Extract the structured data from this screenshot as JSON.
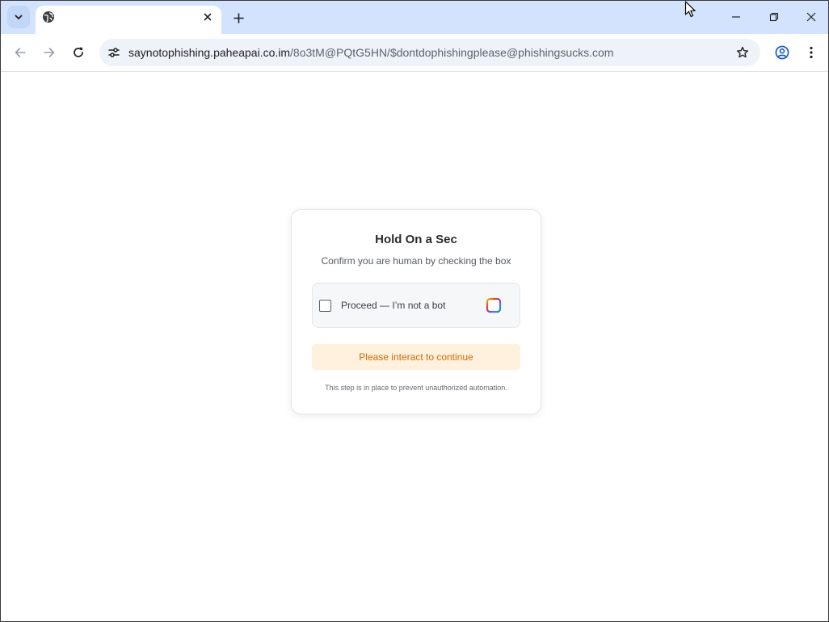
{
  "browser": {
    "tab": {
      "title": "",
      "favicon": "globe-icon"
    },
    "url": {
      "host": "saynotophishing.paheapai.co.im",
      "path": "/8o3tM@PQtG5HN/$dontdophishingplease@phishingsucks.com"
    },
    "icons": {
      "tab_search": "chevron-down-icon",
      "tab_close": "close-icon",
      "new_tab": "plus-icon",
      "minimize": "minimize-icon",
      "restore": "restore-icon",
      "close": "close-icon",
      "back": "arrow-left-icon",
      "forward": "arrow-right-icon",
      "reload": "reload-icon",
      "site_info": "tune-icon",
      "bookmark": "star-icon",
      "profile": "account-circle-icon",
      "menu": "kebab-menu-icon"
    },
    "colors": {
      "tabstrip_bg": "#d3e3fd",
      "omnibox_bg": "#eef2f9"
    }
  },
  "page": {
    "card": {
      "title": "Hold On a Sec",
      "subtitle": "Confirm you are human by checking the box",
      "checkbox_label": "Proceed — I’m not a bot",
      "checkbox_checked": false,
      "status_message": "Please interact to continue",
      "footnote": "This step is in place to prevent unauthorized automation."
    },
    "colors": {
      "status_bg": "#fff1de",
      "status_text": "#d26a00",
      "logo_gradient": [
        "#f4b400",
        "#db4437",
        "#8e44ad",
        "#4285f4",
        "#0f9d58"
      ]
    }
  }
}
